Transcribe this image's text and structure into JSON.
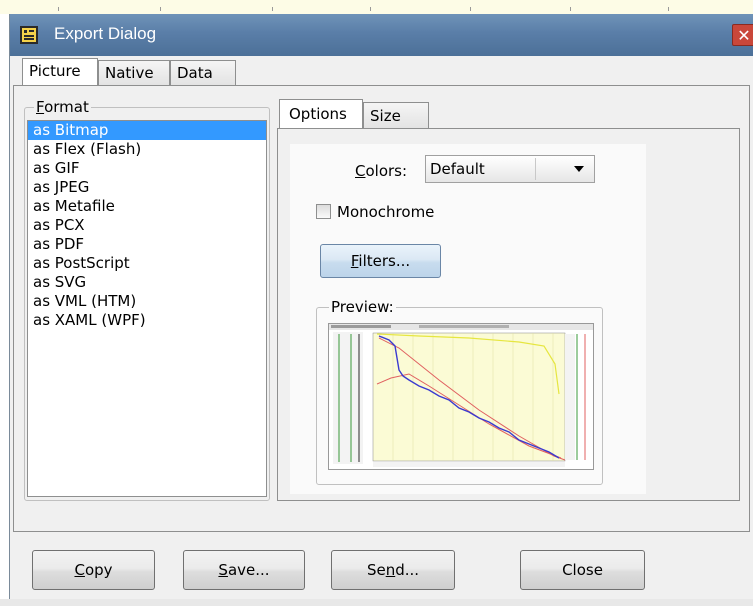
{
  "window": {
    "title": "Export Dialog",
    "close_glyph": "✕"
  },
  "main_tabs": [
    {
      "label": "Picture",
      "active": true
    },
    {
      "label": "Native",
      "active": false
    },
    {
      "label": "Data",
      "active": false
    }
  ],
  "format": {
    "group_label_prefix": "",
    "group_label_accel": "F",
    "group_label_rest": "ormat",
    "items": [
      "as Bitmap",
      "as Flex (Flash)",
      "as GIF",
      "as JPEG",
      "as Metafile",
      "as PCX",
      "as PDF",
      "as PostScript",
      "as SVG",
      "as VML (HTM)",
      "as XAML (WPF)"
    ],
    "selected_index": 0
  },
  "sub_tabs": [
    {
      "label": "Options",
      "active": true
    },
    {
      "label": "Size",
      "active": false
    }
  ],
  "options": {
    "colors_label_accel": "C",
    "colors_label_rest": "olors:",
    "colors_value": "Default",
    "monochrome_label": "Monochrome",
    "monochrome_checked": false,
    "filters_accel": "F",
    "filters_rest": "ilters...",
    "preview_label": "Preview:"
  },
  "buttons": {
    "copy_accel": "C",
    "copy_rest": "opy",
    "save_accel": "S",
    "save_rest": "ave...",
    "send_pre": "Se",
    "send_accel": "n",
    "send_rest": "d...",
    "close_label": "Close"
  },
  "icons": {
    "app_icon": "chart-app-icon",
    "close_icon": "close-icon",
    "dropdown_icon": "chevron-down-icon"
  },
  "colors": {
    "titlebar": "#5a7ea8",
    "selection": "#3399ff",
    "close_button": "#c9473a"
  }
}
